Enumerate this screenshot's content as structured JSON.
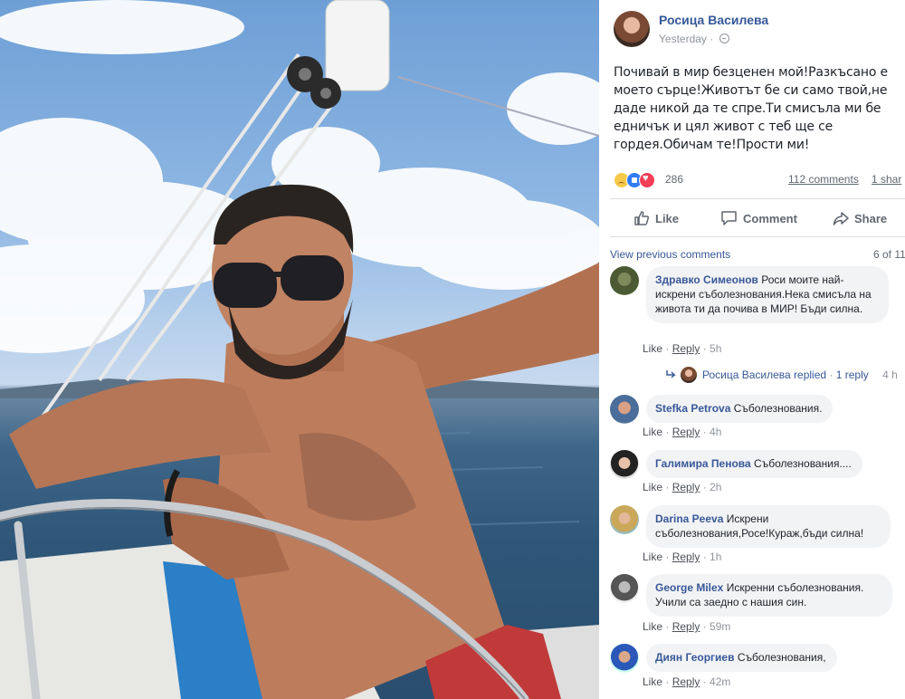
{
  "post": {
    "author": "Росица Василева",
    "time": "Yesterday",
    "text": "Почивай в мир безценен мой!Разкъсано е моето сърце!Животът бе си само твой,не даде никой да те спре.Ти смисъла ми бе едничък и цял живот с теб ще се гордея.Обичам те!Прости ми!",
    "reaction_count": "286",
    "comments_label": "112 comments",
    "shares_label": "1 shar",
    "actions": {
      "like": "Like",
      "comment": "Comment",
      "share": "Share"
    }
  },
  "comments_section": {
    "view_previous": "View previous comments",
    "page_count": "6 of 11",
    "comments": [
      {
        "name": "Здравко Симеонов",
        "text": "Роси моите най-искрени съболезнования.Нека смисъла на живота ти да почива в МИР! Бъди силна.",
        "like": "Like",
        "reply": "Reply",
        "time": "5h"
      },
      {
        "name": "Stefka Petrova",
        "text": "Съболезнования.",
        "like": "Like",
        "reply": "Reply",
        "time": "4h"
      },
      {
        "name": "Галимира Пенова",
        "text": "Съболезнования....",
        "like": "Like",
        "reply": "Reply",
        "time": "2h"
      },
      {
        "name": "Darina Peeva",
        "text": "Искрени съболезнования,Росе!Кураж,бъди силна!",
        "like": "Like",
        "reply": "Reply",
        "time": "1h"
      },
      {
        "name": "George Milex",
        "text": "Искренни съболезнования. Учили са заедно с нашия син.",
        "like": "Like",
        "reply": "Reply",
        "time": "59m"
      },
      {
        "name": "Диян Георгиев",
        "text": "Съболезнования,",
        "like": "Like",
        "reply": "Reply",
        "time": "42m"
      }
    ],
    "reply_summary": {
      "name": "Росица Василева replied",
      "count": "1 reply",
      "time": "4 h"
    }
  },
  "icons": {
    "globe": "globe-icon",
    "like": "thumbs-up-icon",
    "comment": "speech-bubble-icon",
    "share": "share-arrow-icon",
    "reply_arrow": "reply-arrow-icon"
  },
  "colors": {
    "link": "#385898",
    "author": "#365899",
    "bubble": "#f2f3f5",
    "meta": "#90949c"
  }
}
